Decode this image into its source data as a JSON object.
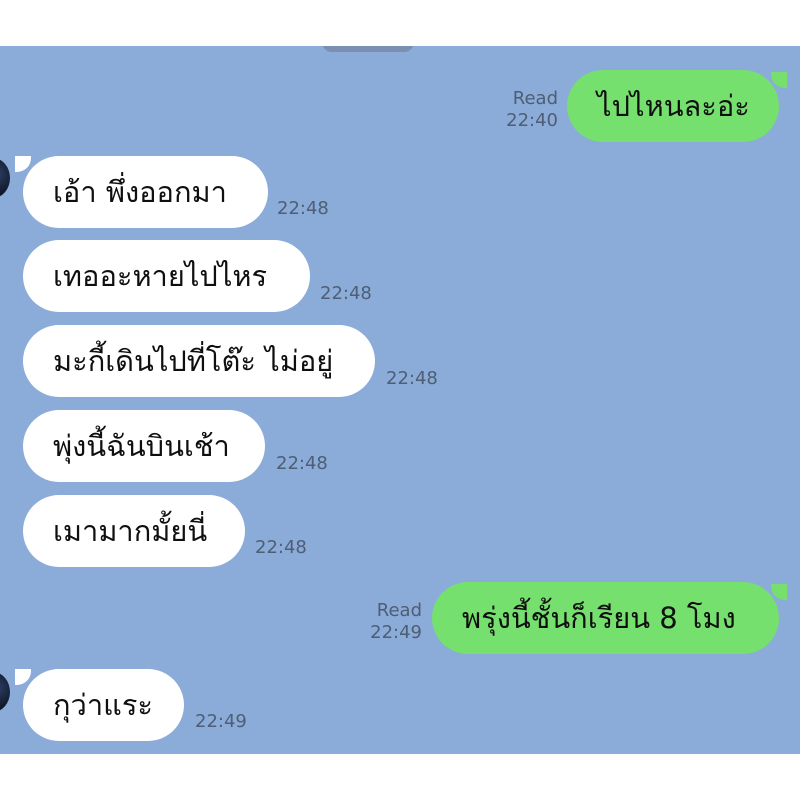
{
  "chat": {
    "messages": [
      {
        "direction": "out",
        "text": "ไปไหนละอ่ะ",
        "status": "Read",
        "time": "22:40"
      },
      {
        "direction": "in",
        "text": "เอ้า พึ่งออกมา",
        "time": "22:48"
      },
      {
        "direction": "in",
        "text": "เทออะหายไปไหร",
        "time": "22:48"
      },
      {
        "direction": "in",
        "text": "มะกี้เดินไปที่โต๊ะ ไม่อยู่",
        "time": "22:48"
      },
      {
        "direction": "in",
        "text": "พุ่งนี้ฉันบินเช้า",
        "time": "22:48"
      },
      {
        "direction": "in",
        "text": "เมามากมั้ยนี่",
        "time": "22:48"
      },
      {
        "direction": "out",
        "text": "พรุ่งนี้ชั้นก็เรียน 8 โมง",
        "status": "Read",
        "time": "22:49"
      },
      {
        "direction": "in",
        "text": "กุว่าแระ",
        "time": "22:49"
      }
    ]
  },
  "colors": {
    "chat_background": "#8babd8",
    "incoming_bubble": "#ffffff",
    "outgoing_bubble": "#76e06f",
    "meta_text": "#4e5e74"
  }
}
